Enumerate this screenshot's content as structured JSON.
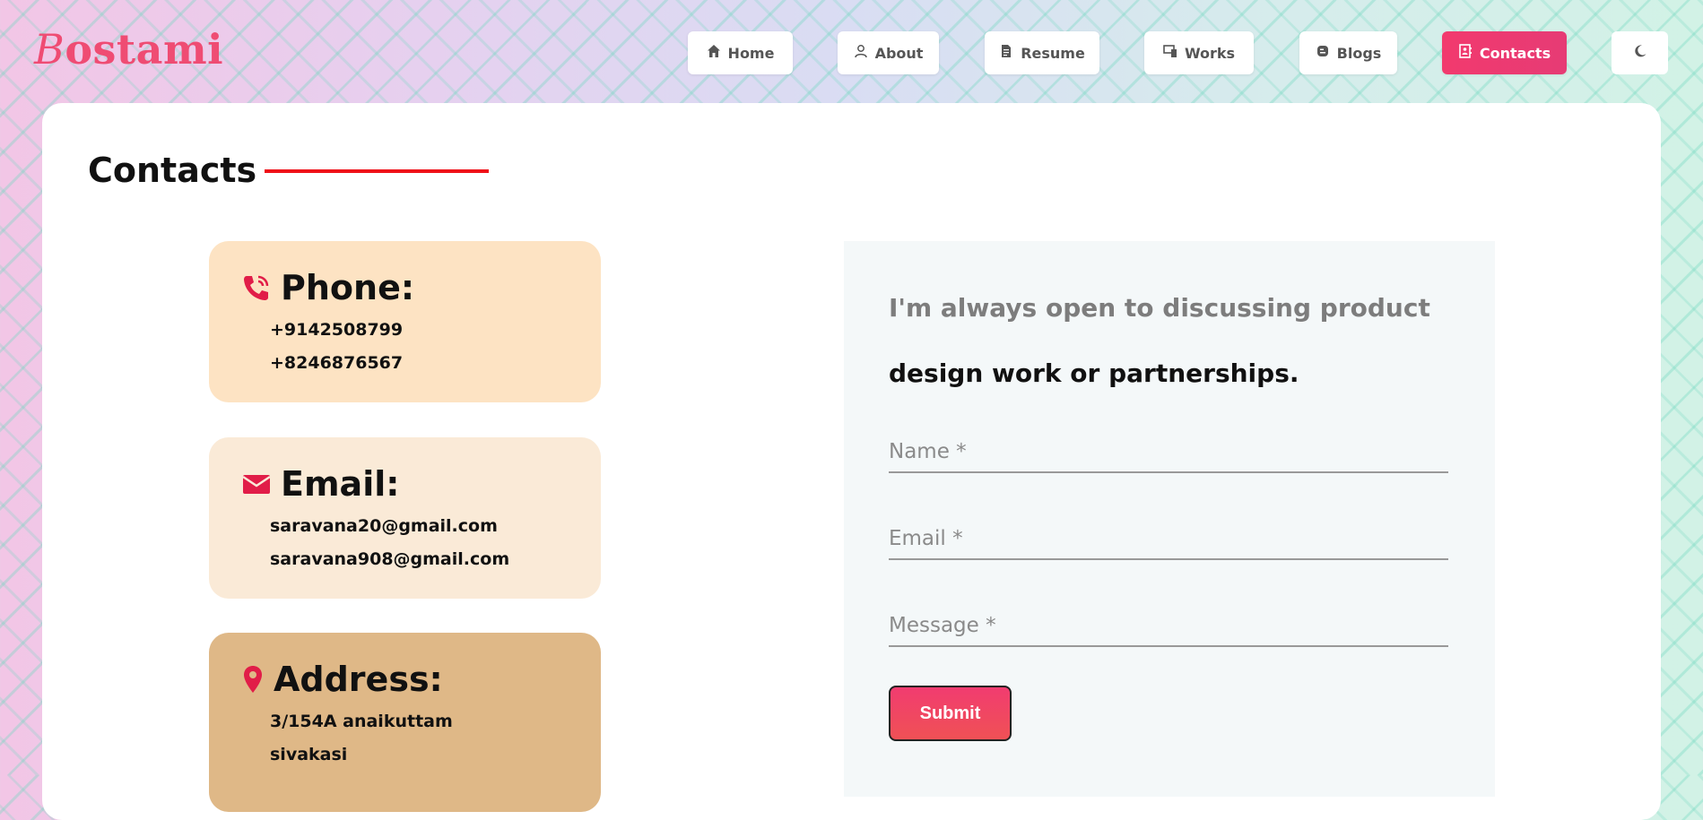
{
  "logo": {
    "first_letter": "B",
    "rest": "ostami"
  },
  "nav": {
    "items": [
      {
        "label": "Home",
        "icon": "home-icon"
      },
      {
        "label": "About",
        "icon": "user-icon"
      },
      {
        "label": "Resume",
        "icon": "document-icon"
      },
      {
        "label": "Works",
        "icon": "works-icon"
      },
      {
        "label": "Blogs",
        "icon": "blog-icon"
      },
      {
        "label": "Contacts",
        "icon": "contacts-icon",
        "active": true
      }
    ],
    "theme_toggle_icon": "moon-icon"
  },
  "page": {
    "title": "Contacts"
  },
  "contact_info": {
    "phone": {
      "heading": "Phone:",
      "lines": [
        "+9142508799",
        "+8246876567"
      ]
    },
    "email": {
      "heading": "Email:",
      "lines": [
        "saravana20@gmail.com",
        "saravana908@gmail.com"
      ]
    },
    "address": {
      "heading": "Address:",
      "lines": [
        "3/154A anaikuttam",
        "sivakasi"
      ]
    }
  },
  "form": {
    "intro_line1": "I'm always open to discussing product",
    "intro_line2": "design work or partnerships.",
    "name_placeholder": "Name *",
    "email_placeholder": "Email *",
    "message_placeholder": "Message *",
    "submit_label": "Submit"
  },
  "colors": {
    "accent": "#ef4c73",
    "active_nav": "#f23a6e",
    "phone_box": "#fde3c3",
    "email_box": "#faead7",
    "address_box": "#dfb887",
    "icon_red": "#e11d48"
  }
}
